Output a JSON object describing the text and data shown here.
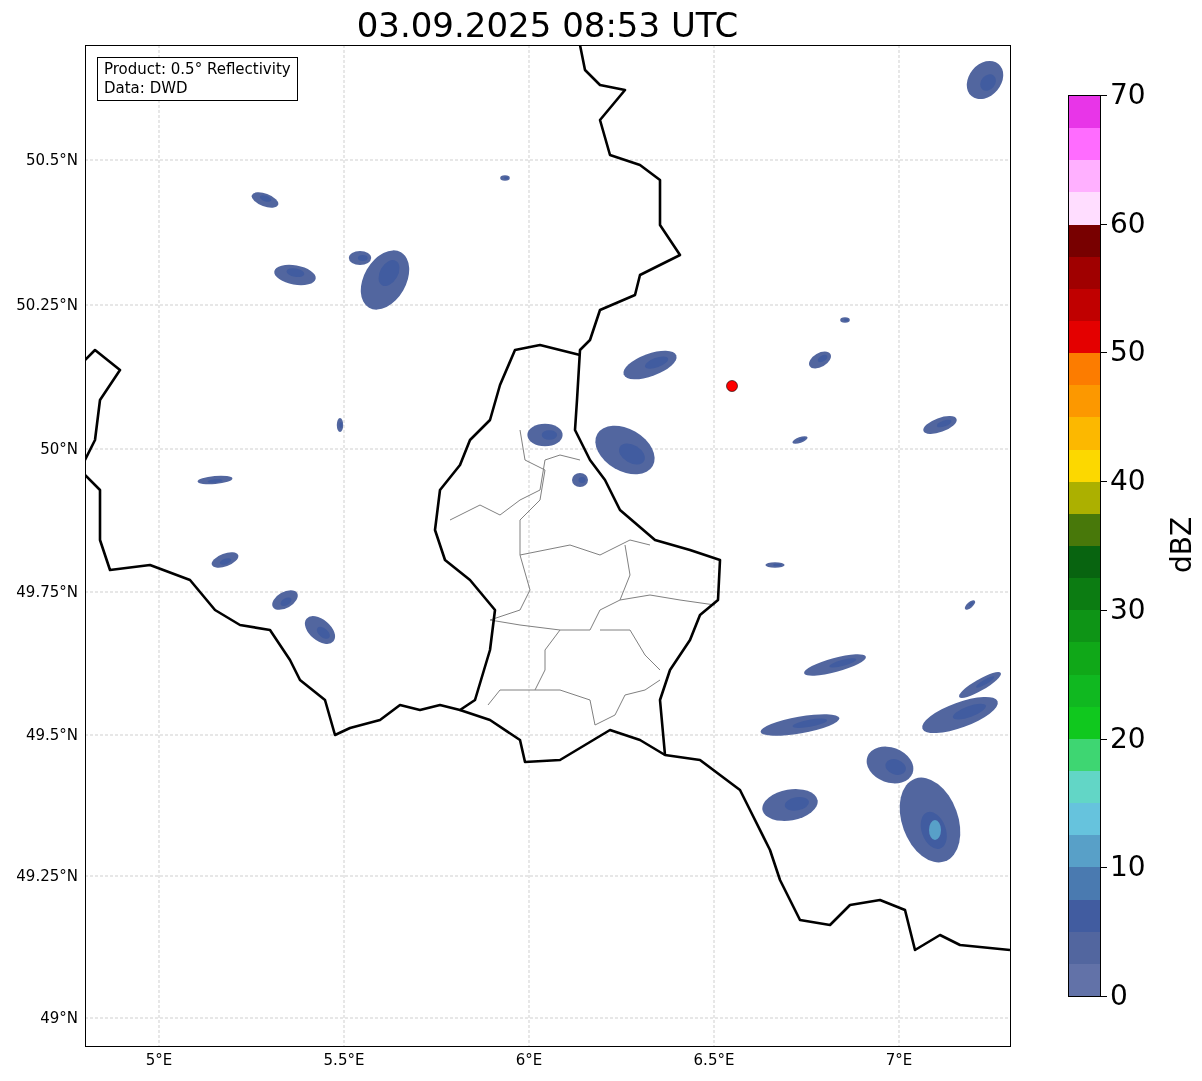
{
  "title": "03.09.2025 08:53 UTC",
  "info_box": [
    "Product: 0.5° Reflectivity",
    "Data: DWD"
  ],
  "map": {
    "lat_labels": [
      "50.5°N",
      "50.25°N",
      "50°N",
      "49.75°N",
      "49.5°N",
      "49.25°N",
      "49°N"
    ],
    "lon_labels": [
      "5°E",
      "5.5°E",
      "6°E",
      "6.5°E",
      "7°E"
    ]
  },
  "colorbar": {
    "label": "dBZ",
    "ticks": [
      "70",
      "60",
      "50",
      "40",
      "30",
      "20",
      "10",
      "0"
    ],
    "bands": [
      {
        "color": "#e835e8"
      },
      {
        "color": "#ff6cff"
      },
      {
        "color": "#ffb0ff"
      },
      {
        "color": "#ffddff"
      },
      {
        "color": "#780000"
      },
      {
        "color": "#a00000"
      },
      {
        "color": "#c00000"
      },
      {
        "color": "#e40000"
      },
      {
        "color": "#fc7c00"
      },
      {
        "color": "#fc9800"
      },
      {
        "color": "#fcb800"
      },
      {
        "color": "#fcd800"
      },
      {
        "color": "#acb000"
      },
      {
        "color": "#48780a"
      },
      {
        "color": "#086410"
      },
      {
        "color": "#0c7c12"
      },
      {
        "color": "#0e9416"
      },
      {
        "color": "#10a818"
      },
      {
        "color": "#10b820"
      },
      {
        "color": "#10c81e"
      },
      {
        "color": "#3ed672"
      },
      {
        "color": "#62d6c6"
      },
      {
        "color": "#66c3dd"
      },
      {
        "color": "#58a0c8"
      },
      {
        "color": "#4a7ab0"
      },
      {
        "color": "#415ca0"
      },
      {
        "color": "#52669f"
      },
      {
        "color": "#6272a8"
      }
    ]
  }
}
